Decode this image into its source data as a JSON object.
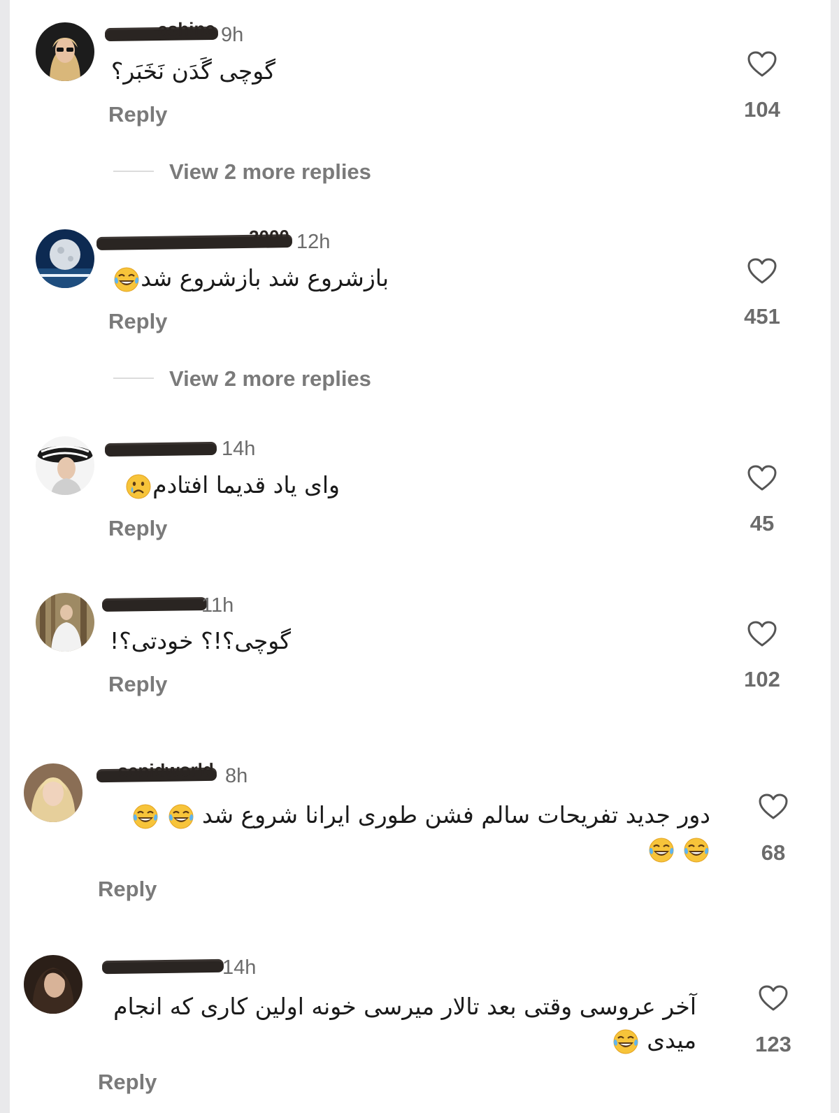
{
  "colors": {
    "page_background": "#ffffff",
    "outer_background": "#e9e9eb",
    "secondary_text": "#7a7a7a",
    "primary_text": "#1a1a1a"
  },
  "comments": [
    {
      "username_visible": "ashine",
      "time": "9h",
      "text": "گوچی گَدَن نَخَبَر؟",
      "emojis": [],
      "reply_label": "Reply",
      "likes": "104",
      "view_more": "View 2 more replies",
      "avatar_icon": "avatar-woman-sunglasses"
    },
    {
      "username_visible": "2000",
      "time": "12h",
      "text": "بازشروع شد بازشروع شد",
      "emojis": [
        "tears-of-joy"
      ],
      "reply_label": "Reply",
      "likes": "451",
      "view_more": "View 2 more replies",
      "avatar_icon": "avatar-moon"
    },
    {
      "username_visible": "",
      "time": "14h",
      "text": "وای یاد قدیما افتادم",
      "emojis": [
        "crying-face"
      ],
      "reply_label": "Reply",
      "likes": "45",
      "avatar_icon": "avatar-woman-hat"
    },
    {
      "username_visible": "",
      "time": "11h",
      "text": "گوچی؟!؟ خودتی؟!",
      "emojis": [],
      "reply_label": "Reply",
      "likes": "102",
      "avatar_icon": "avatar-forest"
    },
    {
      "username_visible": "sepidworld",
      "time": "8h",
      "text": "دور جدید تفریحات سالم فشن طوری ایرانا شروع شد",
      "emojis": [
        "tears-of-joy",
        "tears-of-joy",
        "tears-of-joy",
        "tears-of-joy"
      ],
      "reply_label": "Reply",
      "likes": "68",
      "avatar_icon": "avatar-blonde"
    },
    {
      "username_visible": "",
      "time": "14h",
      "text": "آخر عروسی وقتی بعد تالار میرسی خونه اولین کاری که انجام میدی",
      "emojis": [
        "tears-of-joy"
      ],
      "reply_label": "Reply",
      "likes": "123",
      "avatar_icon": "avatar-dark-hair"
    }
  ]
}
